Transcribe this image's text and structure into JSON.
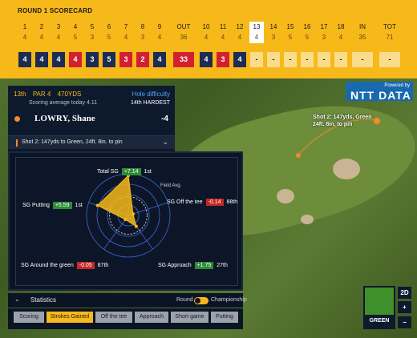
{
  "scorecard": {
    "title": "ROUND 1 SCORECARD",
    "holes": [
      {
        "hole": "1",
        "par": "4",
        "score": "4",
        "kind": "blue"
      },
      {
        "hole": "2",
        "par": "4",
        "score": "4",
        "kind": "blue"
      },
      {
        "hole": "3",
        "par": "4",
        "score": "4",
        "kind": "blue"
      },
      {
        "hole": "4",
        "par": "5",
        "score": "4",
        "kind": "red"
      },
      {
        "hole": "5",
        "par": "3",
        "score": "3",
        "kind": "blue"
      },
      {
        "hole": "6",
        "par": "5",
        "score": "5",
        "kind": "blue"
      },
      {
        "hole": "7",
        "par": "4",
        "score": "3",
        "kind": "red"
      },
      {
        "hole": "8",
        "par": "3",
        "score": "2",
        "kind": "red"
      },
      {
        "hole": "9",
        "par": "4",
        "score": "4",
        "kind": "blue"
      },
      {
        "hole": "OUT",
        "par": "36",
        "score": "33",
        "kind": "red"
      },
      {
        "hole": "10",
        "par": "4",
        "score": "4",
        "kind": "blue"
      },
      {
        "hole": "11",
        "par": "4",
        "score": "3",
        "kind": "red"
      },
      {
        "hole": "12",
        "par": "4",
        "score": "4",
        "kind": "blue"
      },
      {
        "hole": "13",
        "par": "4",
        "score": "-",
        "kind": "empty"
      },
      {
        "hole": "14",
        "par": "3",
        "score": "-",
        "kind": "empty"
      },
      {
        "hole": "15",
        "par": "5",
        "score": "-",
        "kind": "empty"
      },
      {
        "hole": "16",
        "par": "5",
        "score": "-",
        "kind": "empty"
      },
      {
        "hole": "17",
        "par": "3",
        "score": "-",
        "kind": "empty"
      },
      {
        "hole": "18",
        "par": "4",
        "score": "-",
        "kind": "empty"
      },
      {
        "hole": "IN",
        "par": "35",
        "score": "-",
        "kind": "empty"
      },
      {
        "hole": "TOT",
        "par": "71",
        "score": "-",
        "kind": "empty"
      }
    ],
    "current_hole": "13"
  },
  "hole_info": {
    "number": "13th",
    "par": "PAR 4",
    "yards": "470YDS",
    "scoring_average": "Scoring average today 4.11",
    "difficulty_label": "Hole difficulty",
    "difficulty_value": "14th HARDEST"
  },
  "player": {
    "name": "LOWRY, Shane",
    "score": "-4"
  },
  "shot": {
    "text": "Shot 2: 147yds to Green, 24ft. 8in. to pin",
    "map_label": "Shot 2: 147yds, Green 24ft. 8in. to pin"
  },
  "radar": {
    "total": {
      "label": "Total SG",
      "value": "+7.14",
      "rank": "1st"
    },
    "off_tee": {
      "label": "SG Off the tee",
      "value": "-0.14",
      "rank": "88th"
    },
    "approach": {
      "label": "SG Approach",
      "value": "+1.75",
      "rank": "27th"
    },
    "around_green": {
      "label": "SG Around the green",
      "value": "-0.05",
      "rank": "87th"
    },
    "putting": {
      "label": "SG Putting",
      "value": "+5.59",
      "rank": "1st"
    },
    "field_avg": "Field Avg."
  },
  "chart_data": {
    "type": "radar",
    "axes": [
      "Total SG",
      "SG Off the tee",
      "SG Approach",
      "SG Around the green",
      "SG Putting"
    ],
    "values": [
      7.14,
      -0.14,
      1.75,
      -0.05,
      5.59
    ]
  },
  "statistics": {
    "title": "Statistics",
    "round_label": "Round",
    "championship_label": "Championship",
    "tabs": [
      "Scoring",
      "Strokes Gained",
      "Off the tee",
      "Approach",
      "Short game",
      "Putting"
    ],
    "active_tab": "Strokes Gained"
  },
  "sponsor": {
    "powered_by": "Powered by",
    "name": "NTT DATA"
  },
  "map_controls": {
    "view_2d": "2D",
    "zoom_in": "+",
    "zoom_out": "−",
    "mini_label": "GREEN"
  },
  "colors": {
    "accent": "#f7b81a",
    "birdie": "#d32030",
    "par": "#1c2c52",
    "panel": "#0d1a2e"
  }
}
